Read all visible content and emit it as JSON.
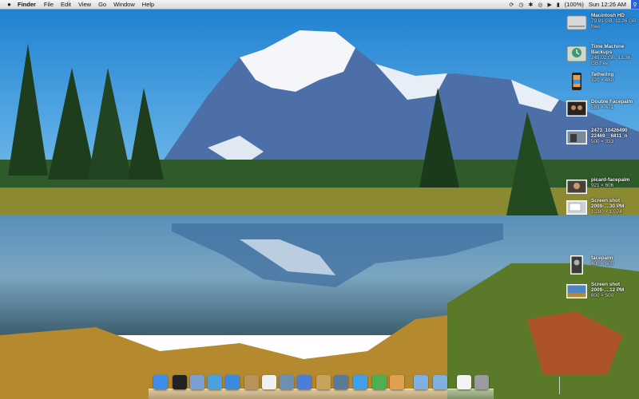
{
  "menubar": {
    "app_name": "Finder",
    "menus": [
      "File",
      "Edit",
      "View",
      "Go",
      "Window",
      "Help"
    ],
    "battery": "(100%)",
    "clock": "Sun 12:26 AM"
  },
  "desktop": {
    "items": [
      {
        "name": "Macintosh HD",
        "sub": "79.81 GB, 11.26 GB free",
        "icon": "hard-drive-icon"
      },
      {
        "name": "Time Machine Backups",
        "sub": "249.02 GB, 13.36 GB free",
        "icon": "time-machine-drive-icon"
      },
      {
        "name": "Tethering",
        "sub": "320 × 480",
        "icon": "iphone-image-icon"
      },
      {
        "name": "Double Facepalm",
        "sub": "589 × 471",
        "icon": "image-thumbnail-icon"
      },
      {
        "name": "2473_10426490 22469__6811_n",
        "sub": "500 × 333",
        "icon": "image-thumbnail-icon"
      },
      {
        "name": "picard-facepalm",
        "sub": "921 × 606",
        "icon": "image-thumbnail-icon"
      },
      {
        "name": "Screen shot 2009-....30 PM",
        "sub": "1,280 × 1,024",
        "icon": "screenshot-thumbnail-icon"
      },
      {
        "name": "facepalm",
        "sub": "400 × 600",
        "icon": "image-thumbnail-icon"
      },
      {
        "name": "Screen shot 2009-....12 PM",
        "sub": "800 × 500",
        "icon": "screenshot-thumbnail-icon"
      }
    ]
  },
  "dock": {
    "items": [
      {
        "icon": "finder-icon",
        "color": "#3d8ee8"
      },
      {
        "icon": "dashboard-icon",
        "color": "#222222"
      },
      {
        "icon": "mail-icon",
        "color": "#7aa0d0"
      },
      {
        "icon": "safari-icon",
        "color": "#4aa0e0"
      },
      {
        "icon": "ichat-icon",
        "color": "#3a8ae0"
      },
      {
        "icon": "address-book-icon",
        "color": "#b8935a"
      },
      {
        "icon": "ical-icon",
        "color": "#f0f0f0"
      },
      {
        "icon": "preview-icon",
        "color": "#6d8fb0"
      },
      {
        "icon": "itunes-icon",
        "color": "#4a7ed8"
      },
      {
        "icon": "iphoto-icon",
        "color": "#c7a35a"
      },
      {
        "icon": "xcode-icon",
        "color": "#5a7a9a"
      },
      {
        "icon": "network-utility-icon",
        "color": "#3fa0e8"
      },
      {
        "icon": "tree-icon",
        "color": "#4caf50"
      },
      {
        "icon": "textedit-icon",
        "color": "#e0a050"
      },
      {
        "icon": "applications-folder-icon",
        "color": "#7fb0e0"
      },
      {
        "icon": "documents-folder-icon",
        "color": "#7fb0e0"
      },
      {
        "icon": "file-icon",
        "color": "#f4f4f4"
      },
      {
        "icon": "trash-icon",
        "color": "#9a9aa0"
      }
    ]
  }
}
